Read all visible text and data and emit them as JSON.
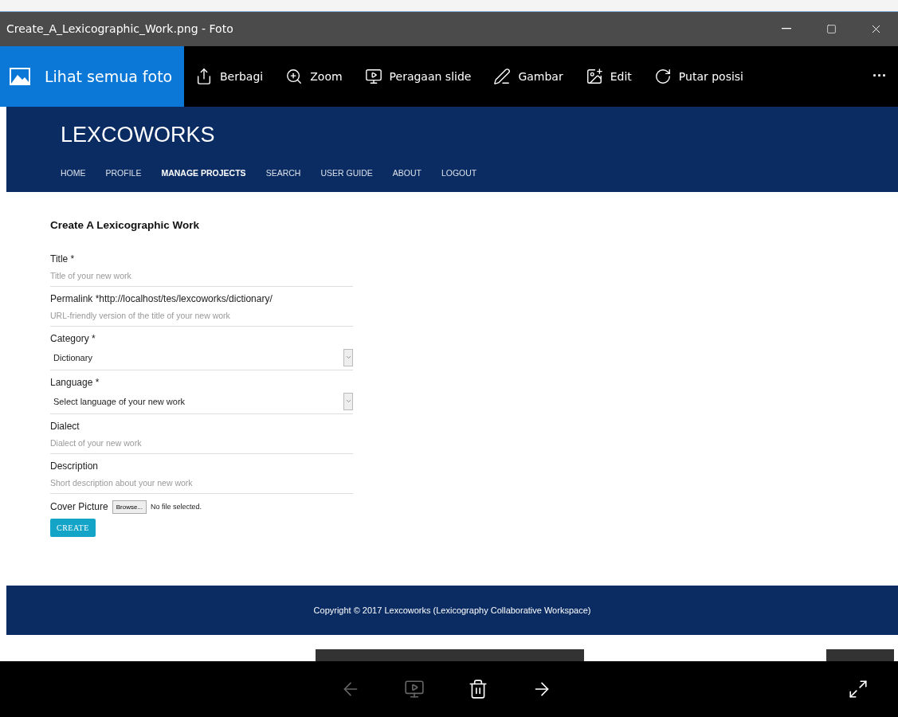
{
  "window": {
    "title": "Create_A_Lexicographic_Work.png - Foto"
  },
  "window_controls": [
    {
      "kind": "minimize"
    },
    {
      "kind": "maximize"
    },
    {
      "kind": "close"
    }
  ],
  "toolbar": {
    "primary": {
      "label": "Lihat semua foto"
    },
    "items": [
      {
        "kind": "share",
        "label": "Berbagi"
      },
      {
        "kind": "zoom",
        "label": "Zoom"
      },
      {
        "kind": "slideshow",
        "label": "Peragaan slide"
      },
      {
        "kind": "draw",
        "label": "Gambar"
      },
      {
        "kind": "edit",
        "label": "Edit"
      },
      {
        "kind": "rotate",
        "label": "Putar posisi"
      }
    ],
    "more": "···"
  },
  "site": {
    "brand": "LEXCOWORKS",
    "nav": [
      {
        "label": "HOME",
        "selected": false
      },
      {
        "label": "PROFILE",
        "selected": false
      },
      {
        "label": "MANAGE PROJECTS",
        "selected": true
      },
      {
        "label": "SEARCH",
        "selected": false
      },
      {
        "label": "USER GUIDE",
        "selected": false
      },
      {
        "label": "ABOUT",
        "selected": false
      },
      {
        "label": "LOGOUT",
        "selected": false
      }
    ],
    "form": {
      "heading": "Create A Lexicographic Work",
      "fields": [
        {
          "kind": "text",
          "label": "Title *",
          "placeholder": "Title of your new work"
        },
        {
          "kind": "text",
          "label": "Permalink *http://localhost/tes/lexcoworks/dictionary/",
          "placeholder": "URL-friendly version of the title of your new work"
        },
        {
          "kind": "select",
          "label": "Category *",
          "value": "Dictionary"
        },
        {
          "kind": "select",
          "label": "Language *",
          "value": "Select language of your new work"
        },
        {
          "kind": "text",
          "label": "Dialect",
          "placeholder": "Dialect of your new work"
        },
        {
          "kind": "text",
          "label": "Description",
          "placeholder": "Short description about your new work"
        }
      ],
      "file": {
        "label": "Cover Picture",
        "button": "Browse...",
        "status": "No file selected."
      },
      "submit": "CREATE"
    },
    "footer": "Copyright © 2017 Lexcoworks (Lexicography Collaborative Workspace)"
  },
  "bottom_bar": [
    {
      "kind": "previous",
      "disabled": true
    },
    {
      "kind": "slideshow",
      "disabled": true
    },
    {
      "kind": "delete",
      "disabled": false
    },
    {
      "kind": "next",
      "disabled": false
    },
    {
      "kind": "fullscreen",
      "disabled": false
    }
  ]
}
